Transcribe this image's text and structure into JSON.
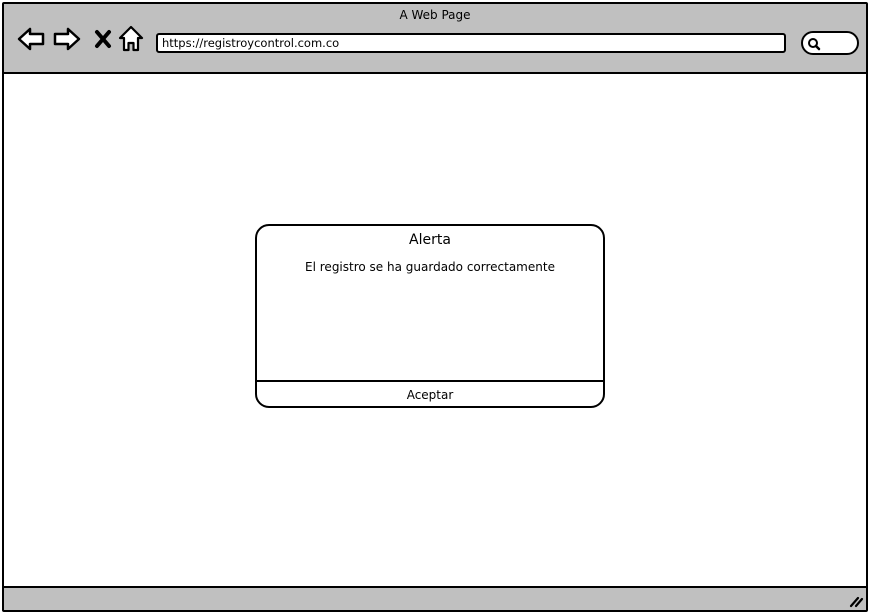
{
  "window": {
    "title": "A Web Page"
  },
  "toolbar": {
    "icons": [
      "back-arrow-icon",
      "forward-arrow-icon",
      "stop-icon",
      "home-icon",
      "search-icon",
      "resize-grip-icon"
    ],
    "url": "https://registroycontrol.com.co"
  },
  "dialog": {
    "title": "Alerta",
    "message": "El registro se ha guardado correctamente",
    "button_label": "Aceptar"
  },
  "colors": {
    "chrome": "#c0c0c0",
    "border": "#000000",
    "content_background": "#ffffff"
  }
}
